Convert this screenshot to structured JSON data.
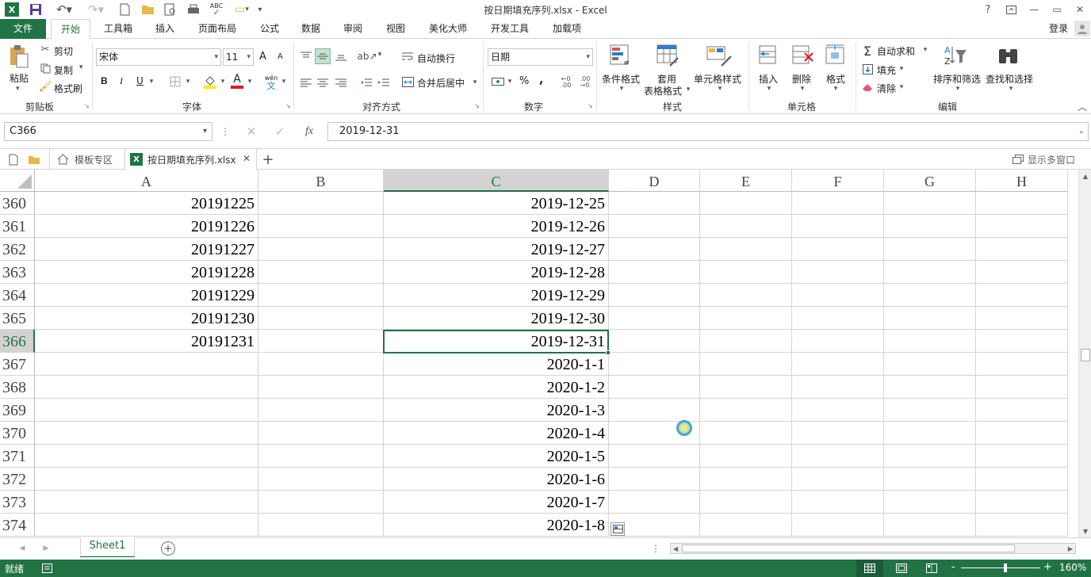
{
  "window": {
    "title": "按日期填充序列.xlsx - Excel",
    "help": "?",
    "minimize": "—",
    "restore": "▭",
    "close": "✕"
  },
  "tabs": [
    "文件",
    "开始",
    "工具箱",
    "插入",
    "页面布局",
    "公式",
    "数据",
    "审阅",
    "视图",
    "美化大师",
    "开发工具",
    "加载项"
  ],
  "login": "登录",
  "clipboard": {
    "paste": "粘贴",
    "cut": "剪切",
    "copy": "复制",
    "format_painter": "格式刷",
    "label": "剪贴板"
  },
  "font": {
    "name": "宋体",
    "size": "11",
    "label": "字体",
    "grow": "A",
    "shrink": "A",
    "bold": "B",
    "italic": "I",
    "underline": "U",
    "wen": "wén",
    "wen2": "文"
  },
  "alignment": {
    "wrap": "自动换行",
    "merge": "合并后居中",
    "label": "对齐方式"
  },
  "number": {
    "format": "日期",
    "percent": "%",
    "comma": ",",
    "label": "数字"
  },
  "styles": {
    "conditional": "条件格式",
    "table_line1": "套用",
    "table_line2": "表格格式",
    "cell_styles": "单元格样式",
    "label": "样式"
  },
  "cells": {
    "insert": "插入",
    "delete": "删除",
    "format": "格式",
    "label": "单元格"
  },
  "editing": {
    "autosum": "自动求和",
    "fill": "填充",
    "clear": "清除",
    "sort": "排序和筛选",
    "find": "查找和选择",
    "label": "编辑"
  },
  "formula_bar": {
    "name_box": "C366",
    "fx": "fx",
    "value": "2019-12-31"
  },
  "doc_tabs": {
    "templates": "模板专区",
    "file": "按日期填充序列.xlsx",
    "multi_window": "显示多窗口"
  },
  "columns": [
    "A",
    "B",
    "C",
    "D",
    "E",
    "F",
    "G",
    "H"
  ],
  "rows": [
    {
      "num": "360",
      "a": "20191225",
      "c": "2019-12-25"
    },
    {
      "num": "361",
      "a": "20191226",
      "c": "2019-12-26"
    },
    {
      "num": "362",
      "a": "20191227",
      "c": "2019-12-27"
    },
    {
      "num": "363",
      "a": "20191228",
      "c": "2019-12-28"
    },
    {
      "num": "364",
      "a": "20191229",
      "c": "2019-12-29"
    },
    {
      "num": "365",
      "a": "20191230",
      "c": "2019-12-30"
    },
    {
      "num": "366",
      "a": "20191231",
      "c": "2019-12-31"
    },
    {
      "num": "367",
      "a": "",
      "c": "2020-1-1"
    },
    {
      "num": "368",
      "a": "",
      "c": "2020-1-2"
    },
    {
      "num": "369",
      "a": "",
      "c": "2020-1-3"
    },
    {
      "num": "370",
      "a": "",
      "c": "2020-1-4"
    },
    {
      "num": "371",
      "a": "",
      "c": "2020-1-5"
    },
    {
      "num": "372",
      "a": "",
      "c": "2020-1-6"
    },
    {
      "num": "373",
      "a": "",
      "c": "2020-1-7"
    },
    {
      "num": "374",
      "a": "",
      "c": "2020-1-8"
    }
  ],
  "sheet": {
    "name": "Sheet1",
    "add": "+"
  },
  "status": {
    "ready": "就绪",
    "zoom": "160%",
    "zoom_minus": "-",
    "zoom_plus": "+"
  },
  "colors": {
    "accent": "#217346",
    "selected_header": "#d3d3d3"
  }
}
